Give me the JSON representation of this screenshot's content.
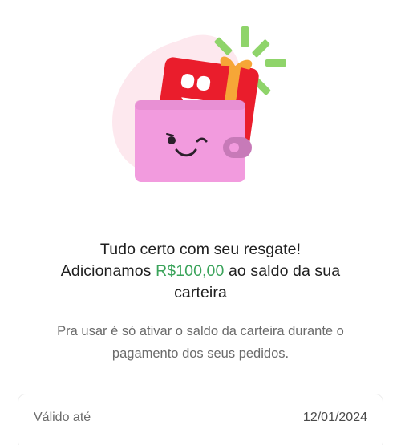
{
  "illustration": {
    "icon": "wallet-with-gift-card-icon"
  },
  "message": {
    "line1": "Tudo certo com seu resgate!",
    "line2_prefix": "Adicionamos",
    "amount": "R$100,00",
    "line2_suffix": "ao saldo da sua",
    "line3": "carteira",
    "description": "Pra usar é só ativar o saldo da carteira durante o pagamento dos seus pedidos."
  },
  "validity": {
    "label": "Válido até",
    "date": "12/01/2024"
  },
  "colors": {
    "amount": "#3aa35a",
    "wallet": "#f29bde",
    "card": "#ea1d2c",
    "sparkle": "#8fd46a"
  }
}
